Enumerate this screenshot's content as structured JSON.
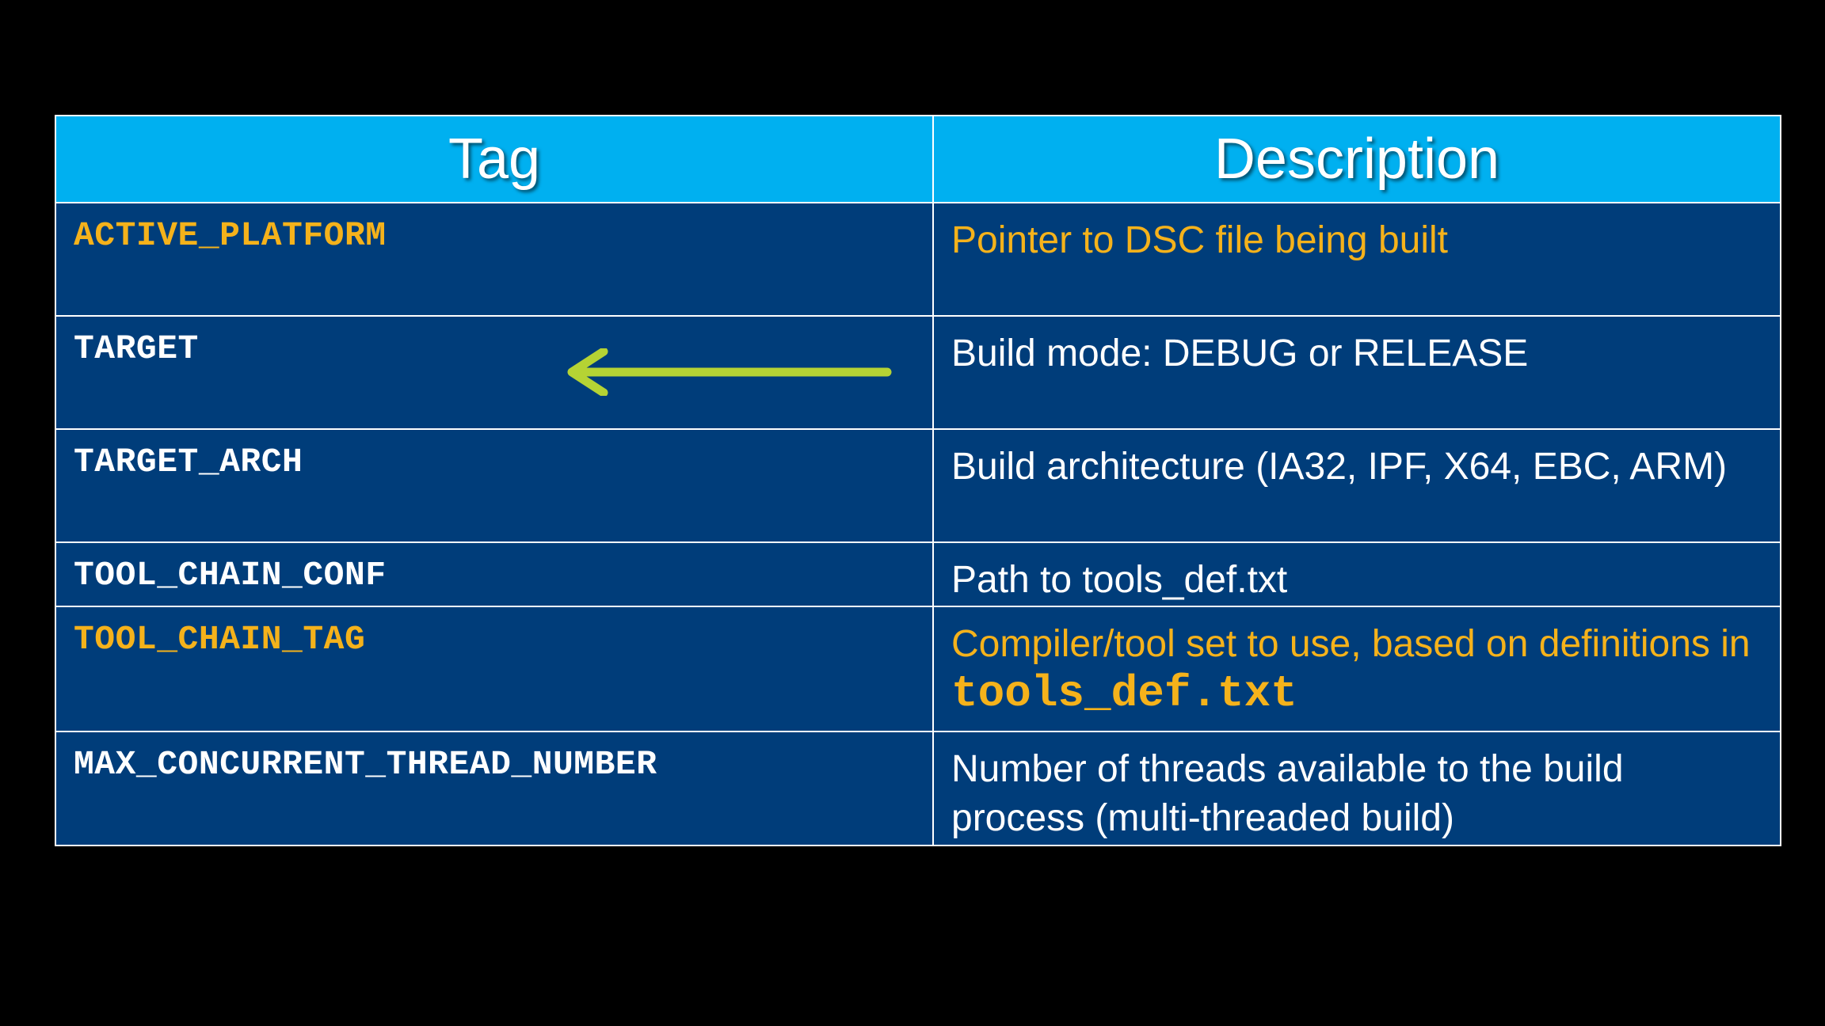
{
  "table": {
    "header": {
      "tag": "Tag",
      "description": "Description"
    },
    "rows": [
      {
        "tag": "ACTIVE_PLATFORM",
        "description": "Pointer to DSC file being built",
        "highlight": true
      },
      {
        "tag": "TARGET",
        "description": "Build mode: DEBUG or RELEASE",
        "highlight": false
      },
      {
        "tag": "TARGET_ARCH",
        "description": "Build architecture (IA32, IPF, X64, EBC, ARM)",
        "highlight": false
      },
      {
        "tag": "TOOL_CHAIN_CONF",
        "description": "Path to tools_def.txt",
        "highlight": false
      },
      {
        "tag": "TOOL_CHAIN_TAG",
        "description_prefix": "Compiler/tool set to use, based on definitions in",
        "description_code": "tools_def.txt",
        "highlight": true
      },
      {
        "tag": "MAX_CONCURRENT_THREAD_NUMBER",
        "description": "Number of threads available to the build process (multi-threaded build)",
        "highlight": false
      }
    ]
  },
  "annotation": {
    "arrow_icon": "left-arrow-icon",
    "arrow_color": "#b5d334"
  },
  "colors": {
    "header_bg": "#00b0f0",
    "cell_bg": "#003d7a",
    "highlight_text": "#f5b21b",
    "border": "#ffffff"
  }
}
